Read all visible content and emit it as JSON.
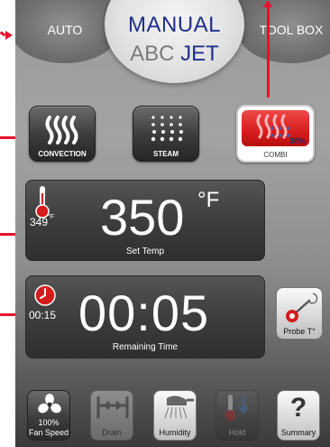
{
  "tabs": {
    "auto": "AUTO",
    "toolbox": "TOOL BOX"
  },
  "mode_display": {
    "line1": "MANUAL",
    "abc": "ABC",
    "jet": "JET"
  },
  "cook_modes": {
    "convection": "CONVECTION",
    "steam": "STEAM",
    "combi": "COMBI",
    "combi_percent": "30%"
  },
  "temperature": {
    "set_value": "350",
    "set_unit": "°F",
    "label": "Set Temp",
    "actual_value": "349",
    "actual_unit": "°F"
  },
  "timer": {
    "value": "00:05",
    "label": "Remaining Time",
    "actual_value": "00:15"
  },
  "probe": {
    "label": "Probe T°"
  },
  "bottom_bar": {
    "fan_percent": "100%",
    "fan_label": "Fan Speed",
    "drain_label": "Drain",
    "humidity_label": "Humidity",
    "hold_label": "Hold",
    "summary_label": "Summary",
    "summary_glyph": "?"
  },
  "colors": {
    "accent_blue": "#1f2f8a",
    "combi_red": "#d61c1c",
    "annotation_red": "#e8102a"
  }
}
